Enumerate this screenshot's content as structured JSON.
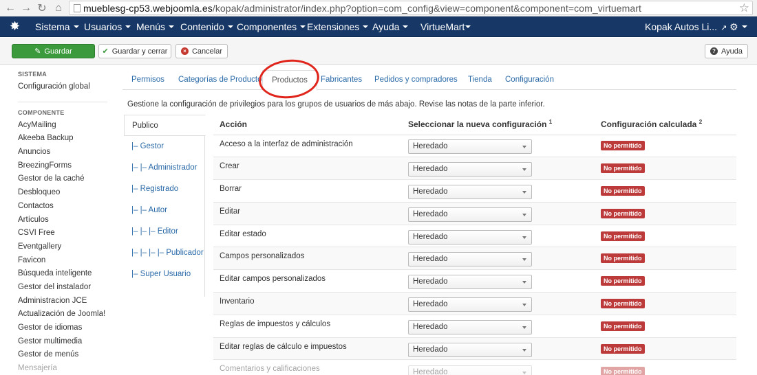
{
  "browser": {
    "url_host": "mueblesg-cp53.webjoomla.es",
    "url_path": "/kopak/administrator/index.php?option=com_config&view=component&component=com_virtuemart"
  },
  "topnav": {
    "items": [
      "Sistema",
      "Usuarios",
      "Menús",
      "Contenido",
      "Componentes",
      "Extensiones",
      "Ayuda",
      "VirtueMart"
    ],
    "site_name": "Kopak Autos Li..."
  },
  "toolbar": {
    "save_label": "Guardar",
    "save_close_label": "Guardar y cerrar",
    "cancel_label": "Cancelar",
    "help_label": "Ayuda"
  },
  "sidebar": {
    "system_heading": "SISTEMA",
    "global_config": "Configuración global",
    "component_heading": "COMPONENTE",
    "components": [
      "AcyMailing",
      "Akeeba Backup",
      "Anuncios",
      "BreezingForms",
      "Gestor de la caché",
      "Desbloqueo",
      "Contactos",
      "Artículos",
      "CSVI Free",
      "Eventgallery",
      "Favicon",
      "Búsqueda inteligente",
      "Gestor del instalador",
      "Administracion JCE",
      "Actualización de Joomla!",
      "Gestor de idiomas",
      "Gestor multimedia",
      "Gestor de menús",
      "Mensajería"
    ]
  },
  "tabs": [
    "Permisos",
    "Categorías de Producto",
    "Productos",
    "Fabricantes",
    "Pedidos y compradores",
    "Tienda",
    "Configuración"
  ],
  "active_tab": "Productos",
  "intro": "Gestione la configuración de privilegios para los grupos de usuarios de más abajo. Revise las notas de la parte inferior.",
  "groups": [
    "Publico",
    "|– Gestor",
    "|– |– Administrador",
    "|– Registrado",
    "|– |– Autor",
    "|– |– |– Editor",
    "|– |– |– |– Publicador",
    "|– Super Usuario"
  ],
  "table": {
    "col_action": "Acción",
    "col_select": "Seleccionar la nueva configuración",
    "col_select_note": "1",
    "col_calc": "Configuración calculada",
    "col_calc_note": "2",
    "select_value": "Heredado",
    "badge_label": "No permitido",
    "rows": [
      "Acceso a la interfaz de administración",
      "Crear",
      "Borrar",
      "Editar",
      "Editar estado",
      "Campos personalizados",
      "Editar campos personalizados",
      "Inventario",
      "Reglas de impuestos y cálculos",
      "Editar reglas de cálculo e impuestos",
      "Comentarios y calificaciones"
    ]
  },
  "colors": {
    "topnav_bg": "#173866",
    "save_green": "#3b9a3b",
    "badge_red": "#bd3a3a",
    "link_blue": "#2a6aa8",
    "annotation_circle": "#e0261c"
  }
}
